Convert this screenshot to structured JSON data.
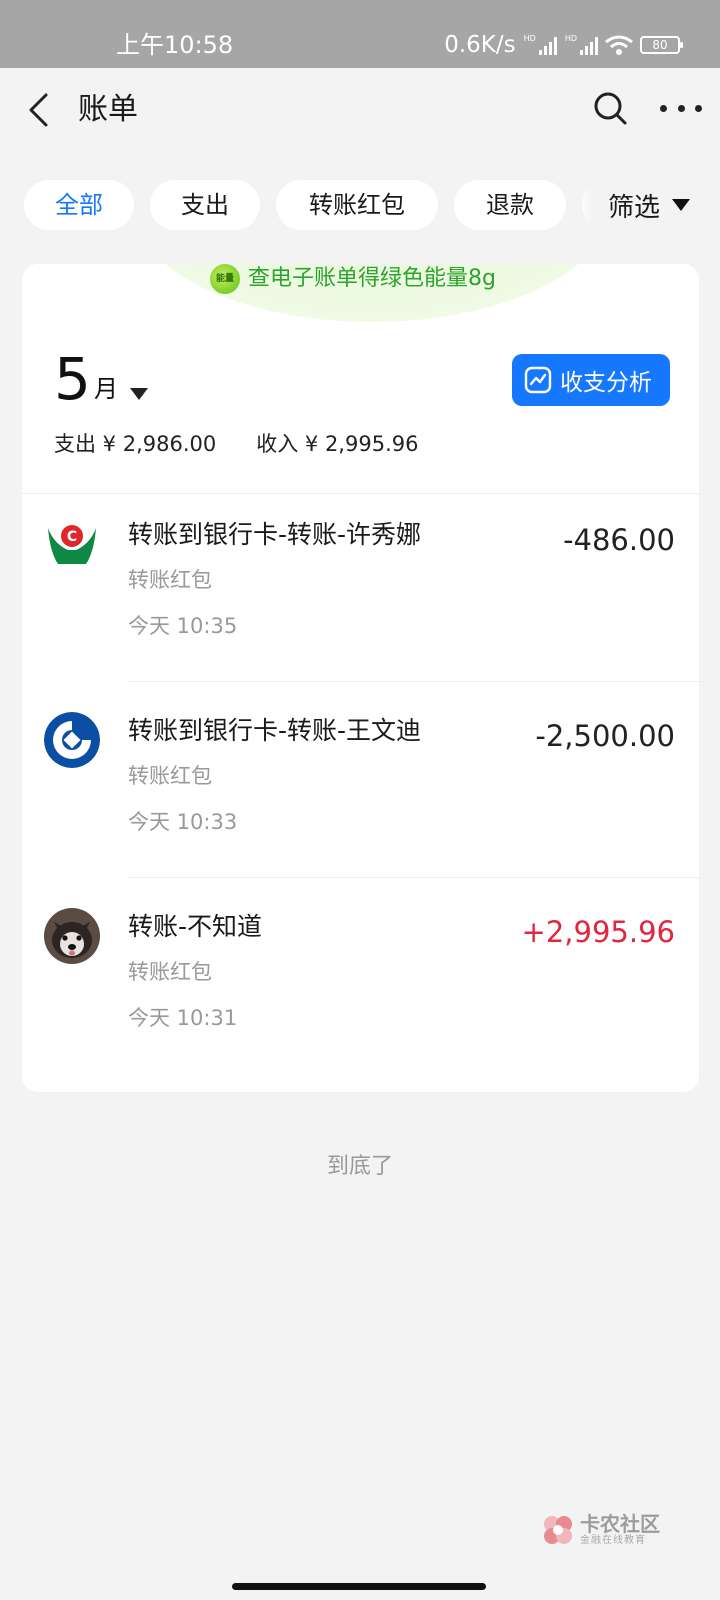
{
  "status_bar": {
    "time": "上午10:58",
    "net_speed": "0.6K/s",
    "battery": "80"
  },
  "header": {
    "title": "账单"
  },
  "filters": {
    "chips": [
      "全部",
      "支出",
      "转账红包",
      "退款"
    ],
    "filter_label": "筛选"
  },
  "promo": {
    "badge": "能量",
    "text": "查电子账单得绿色能量8g"
  },
  "month": {
    "number": "5",
    "unit": "月"
  },
  "analysis_button": "收支分析",
  "summary": {
    "expense": "支出 ¥ 2,986.00",
    "income": "收入 ¥ 2,995.96"
  },
  "transactions": [
    {
      "title": "转账到银行卡-转账-许秀娜",
      "category": "转账红包",
      "time": "今天 10:35",
      "amount": "-486.00",
      "icon": "abc-bank-logo-icon"
    },
    {
      "title": "转账到银行卡-转账-王文迪",
      "category": "转账红包",
      "time": "今天 10:33",
      "amount": "-2,500.00",
      "icon": "ccb-bank-logo-icon"
    },
    {
      "title": "转账-不知道",
      "category": "转账红包",
      "time": "今天 10:31",
      "amount": "+2,995.96",
      "icon": "dog-avatar"
    }
  ],
  "end_text": "到底了",
  "watermark": {
    "title": "卡农社区",
    "subtitle": "金融在线教育"
  },
  "colors": {
    "accent": "#1677ff",
    "income": "#e0273d",
    "promo_green": "#2fa32f"
  }
}
